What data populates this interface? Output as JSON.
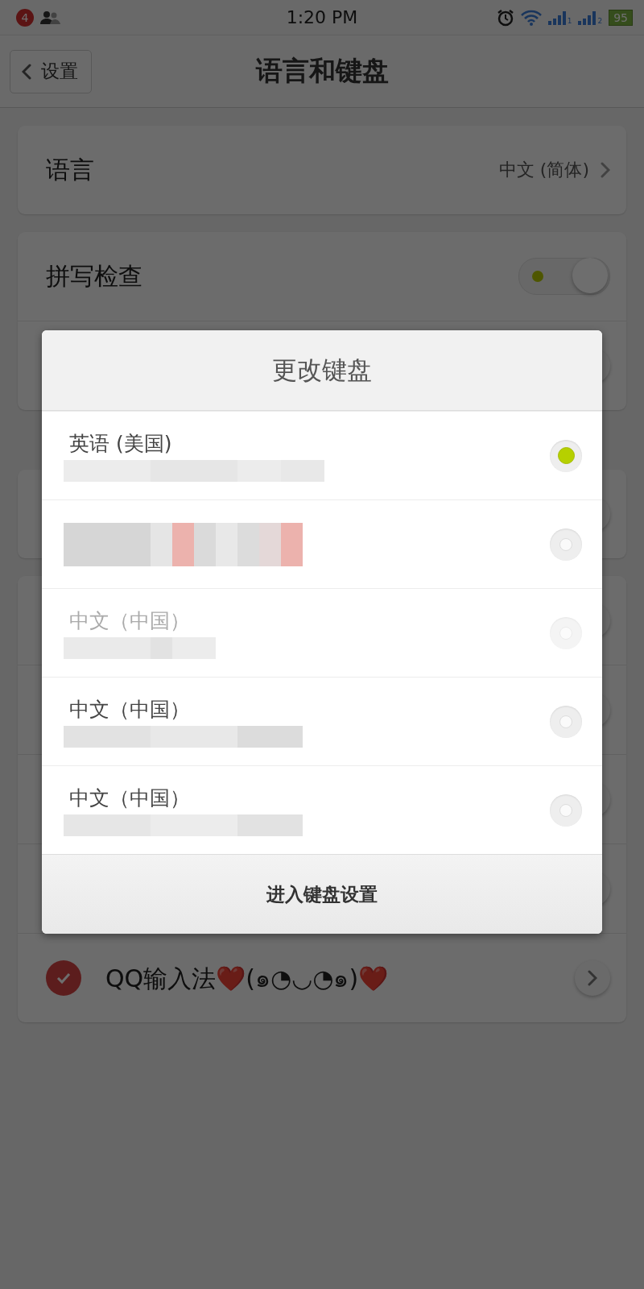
{
  "status_bar": {
    "notification_count": "4",
    "time": "1:20 PM",
    "signals": [
      {
        "sim": "1"
      },
      {
        "sim": "2"
      }
    ],
    "battery": "95"
  },
  "nav": {
    "back": "设置",
    "title": "语言和键盘"
  },
  "cards": [
    {
      "rows": [
        {
          "kind": "link",
          "label": "语言",
          "value": "中文 (简体)"
        }
      ]
    },
    {
      "rows": [
        {
          "kind": "toggle",
          "label": "拼写检查",
          "on": true
        },
        {
          "kind": "link"
        }
      ]
    },
    {
      "rows": [
        {
          "kind": "link"
        }
      ]
    },
    {
      "rows": [
        {
          "kind": "link"
        },
        {
          "kind": "link"
        },
        {
          "kind": "link"
        },
        {
          "kind": "link"
        },
        {
          "kind": "keyboard",
          "label": "QQ输入法❤️(๑◔◡◔๑)❤️",
          "checked": true
        }
      ]
    }
  ],
  "dialog": {
    "title": "更改键盘",
    "options": [
      {
        "label": "英语 (美国)",
        "selected": true,
        "disabled": false
      },
      {
        "selected": false,
        "disabled": false
      },
      {
        "label": "中文（中国）",
        "selected": false,
        "disabled": true
      },
      {
        "label": "中文（中国）",
        "selected": false,
        "disabled": false
      },
      {
        "label": "中文（中国）",
        "selected": false,
        "disabled": false
      }
    ],
    "button": "进入键盘设置"
  }
}
